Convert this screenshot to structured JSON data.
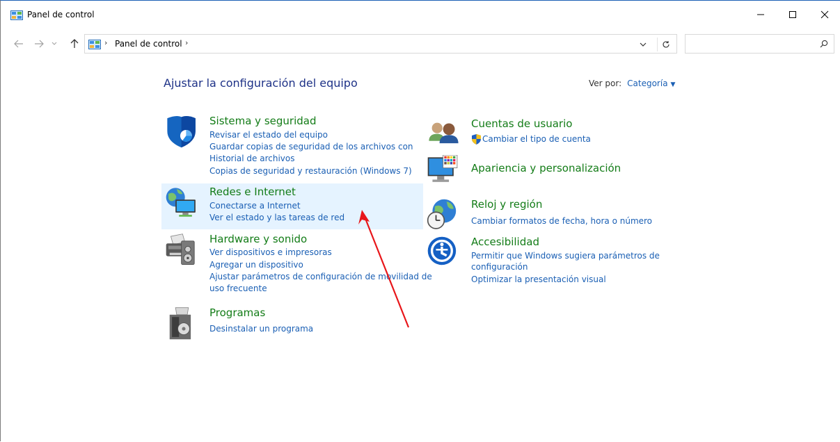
{
  "window": {
    "title": "Panel de control",
    "minimize_glyph": "—",
    "maximize_glyph": "☐",
    "close_glyph": "✕"
  },
  "nav": {
    "back_glyph": "←",
    "forward_glyph": "→",
    "history_glyph": "⌄",
    "up_glyph": "↑",
    "separator": "›",
    "breadcrumb": "Panel de control",
    "dropdown_glyph": "⌄",
    "refresh_glyph": "↻"
  },
  "search": {
    "value": "",
    "placeholder": ""
  },
  "main": {
    "heading": "Ajustar la configuración del equipo",
    "view_by_label": "Ver por:",
    "view_by_value": "Categoría",
    "view_by_caret": "▼"
  },
  "categories": {
    "system": {
      "title": "Sistema y seguridad",
      "links": [
        "Revisar el estado del equipo",
        "Guardar copias de seguridad de los archivos con",
        "Historial de archivos",
        "Copias de seguridad y restauración (Windows 7)"
      ]
    },
    "network": {
      "title": "Redes e Internet",
      "links": [
        "Conectarse a Internet",
        "Ver el estado y las tareas de red"
      ]
    },
    "hardware": {
      "title": "Hardware y sonido",
      "links": [
        "Ver dispositivos e impresoras",
        "Agregar un dispositivo",
        "Ajustar parámetros de configuración de movilidad de",
        "uso frecuente"
      ]
    },
    "programs": {
      "title": "Programas",
      "links": [
        "Desinstalar un programa"
      ]
    },
    "users": {
      "title": "Cuentas de usuario",
      "links": [
        "Cambiar el tipo de cuenta"
      ]
    },
    "appearance": {
      "title": "Apariencia y personalización",
      "links": []
    },
    "clock": {
      "title": "Reloj y región",
      "links": [
        "Cambiar formatos de fecha, hora o número"
      ]
    },
    "access": {
      "title": "Accesibilidad",
      "links": [
        "Permitir que Windows sugiera parámetros de",
        "configuración",
        "Optimizar la presentación visual"
      ]
    }
  },
  "colors": {
    "title_green": "#137c17",
    "link_blue": "#1a5fb4",
    "heading_blue": "#1e3287",
    "hover_bg": "#e5f3ff",
    "annotation_red": "#e8161a"
  }
}
